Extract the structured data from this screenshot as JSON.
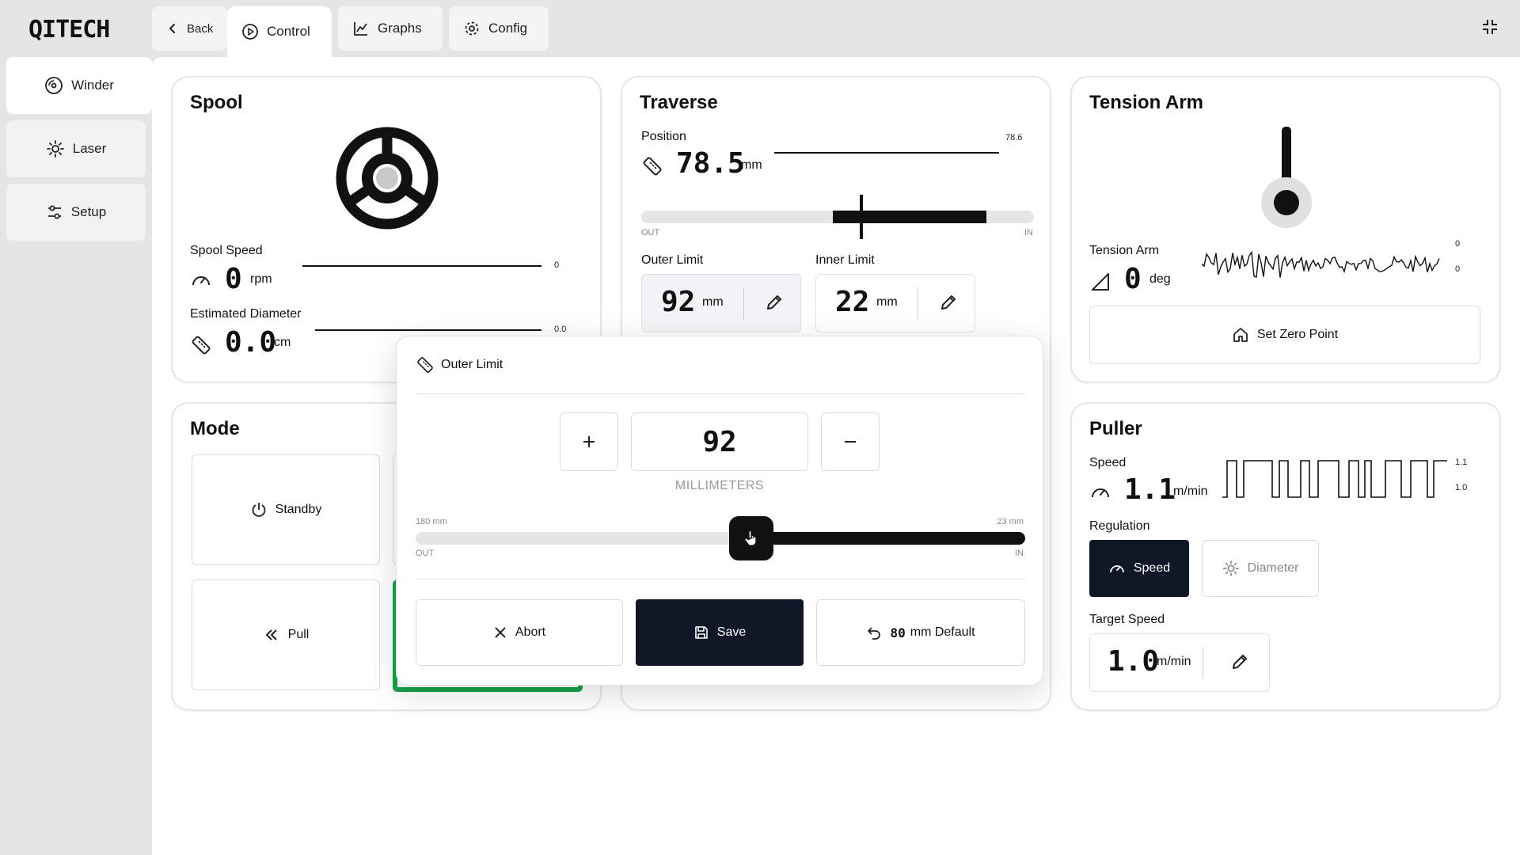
{
  "header": {
    "logo": "QITECH",
    "tabs": [
      {
        "label": "Back",
        "icon": "chevron-left-icon"
      },
      {
        "label": "Control",
        "icon": "play-circle-icon"
      },
      {
        "label": "Graphs",
        "icon": "line-chart-icon"
      },
      {
        "label": "Config",
        "icon": "gear-icon"
      }
    ],
    "active_tab": "Control"
  },
  "sidebar": {
    "items": [
      {
        "label": "Winder",
        "icon": "disc-icon"
      },
      {
        "label": "Laser",
        "icon": "sun-icon"
      },
      {
        "label": "Setup",
        "icon": "sliders-icon"
      }
    ],
    "active": "Winder"
  },
  "spool": {
    "title": "Spool",
    "speed_label": "Spool Speed",
    "speed_value": "0",
    "speed_unit": "rpm",
    "speed_spark_value": "0",
    "diameter_label": "Estimated Diameter",
    "diameter_value": "0.0",
    "diameter_unit": "cm",
    "diameter_spark_value": "0.0"
  },
  "traverse": {
    "title": "Traverse",
    "position_label": "Position",
    "position_value": "78.5",
    "position_unit": "mm",
    "position_spark_value": "78.6",
    "out_label": "OUT",
    "in_label": "IN",
    "outer_limit_label": "Outer Limit",
    "outer_limit_value": "92",
    "outer_limit_unit": "mm",
    "inner_limit_label": "Inner Limit",
    "inner_limit_value": "22",
    "inner_limit_unit": "mm"
  },
  "tension_arm": {
    "title": "Tension Arm",
    "label": "Tension Arm",
    "value": "0",
    "unit": "deg",
    "spark_top": "0",
    "spark_bottom": "0",
    "zero_button": "Set Zero Point"
  },
  "mode": {
    "title": "Mode",
    "buttons": [
      "Standby",
      "Pull"
    ]
  },
  "puller": {
    "title": "Puller",
    "speed_label": "Speed",
    "speed_value": "1.1",
    "speed_unit": "m/min",
    "spark_top": "1.1",
    "spark_bottom": "1.0",
    "regulation_label": "Regulation",
    "regulation_options": [
      "Speed",
      "Diameter"
    ],
    "regulation_selected": "Speed",
    "target_label": "Target Speed",
    "target_value": "1.0",
    "target_unit": "m/min"
  },
  "modal": {
    "title": "Outer Limit",
    "value": "92",
    "unit_caption": "MILLIMETERS",
    "slider_min_label": "180 mm",
    "slider_max_label": "23 mm",
    "out_label": "OUT",
    "in_label": "IN",
    "slider_fraction": 0.55,
    "abort_label": "Abort",
    "save_label": "Save",
    "default_value": "80",
    "default_label": "mm Default"
  },
  "colors": {
    "dark": "#101828",
    "accent_green": "#16a34a",
    "panel_bg": "#e5e5e5"
  }
}
